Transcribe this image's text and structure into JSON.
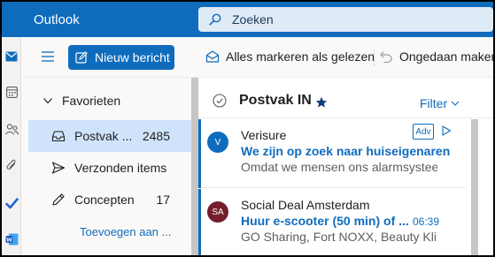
{
  "app": {
    "title": "Outlook"
  },
  "search": {
    "placeholder": "Zoeken"
  },
  "toolbar": {
    "new_message_label": "Nieuw bericht",
    "mark_all_read_label": "Alles markeren als gelezen",
    "undo_label": "Ongedaan maken"
  },
  "folders": {
    "favorites_label": "Favorieten",
    "items": [
      {
        "label": "Postvak ...",
        "count": "2485",
        "icon": "inbox-icon",
        "selected": true
      },
      {
        "label": "Verzonden items",
        "count": "",
        "icon": "send-icon",
        "selected": false
      },
      {
        "label": "Concepten",
        "count": "17",
        "icon": "pencil-icon",
        "selected": false
      }
    ],
    "add_favorite_label": "Toevoegen aan ..."
  },
  "message_list": {
    "title": "Postvak IN",
    "filter_label": "Filter",
    "messages": [
      {
        "avatar": "V",
        "sender": "Verisure",
        "subject": "We zijn op zoek naar huiseigenaren",
        "preview": "Omdat we mensen ons alarmsysteem...",
        "badge": "Adv",
        "time": ""
      },
      {
        "avatar": "SA",
        "sender": "Social Deal Amsterdam",
        "subject": "Huur e-scooter (50 min) of ...",
        "preview": "GO Sharing, Fort NOXX, Beauty Kliniek...",
        "badge": "",
        "time": "06:39"
      }
    ]
  },
  "colors": {
    "brand": "#0f6cbd",
    "selected_folder": "#cfe4fa",
    "avatar_sa": "#751d2b"
  }
}
